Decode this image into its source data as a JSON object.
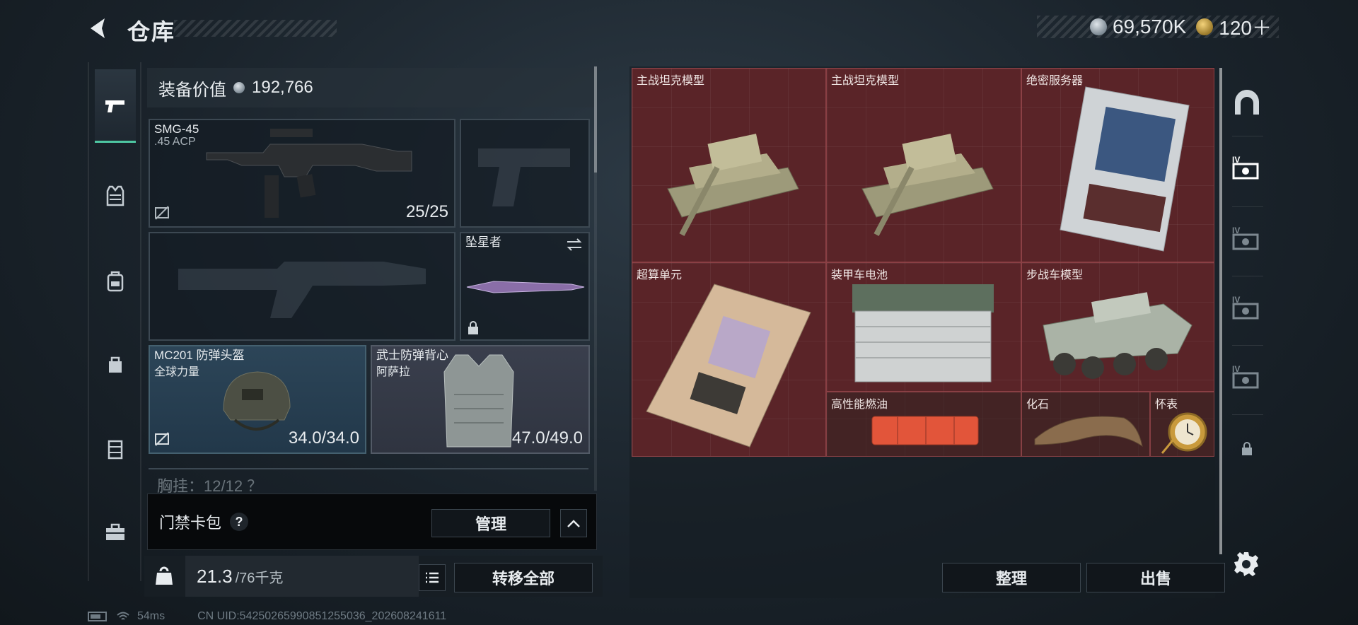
{
  "header": {
    "title": "仓库",
    "currencies": [
      {
        "name": "silver-coin",
        "value": "69,570K",
        "color": "#aab4bb"
      },
      {
        "name": "gold-coin",
        "value": "120＋",
        "color": "#d2a94a"
      }
    ]
  },
  "left_nav": {
    "items": [
      {
        "name": "nav-weapons",
        "icon": "pistol-icon",
        "active": true
      },
      {
        "name": "nav-vest",
        "icon": "vest-icon",
        "active": false
      },
      {
        "name": "nav-backpack",
        "icon": "backpack-icon",
        "active": false
      },
      {
        "name": "nav-pouch",
        "icon": "pouch-icon",
        "active": false
      },
      {
        "name": "nav-case",
        "icon": "case-icon",
        "active": false
      },
      {
        "name": "nav-toolbox",
        "icon": "toolbox-icon",
        "active": false
      }
    ],
    "accent": "#4ec7a2"
  },
  "equipment": {
    "value_label": "装备价值",
    "value": "192,766",
    "primary_weapon": {
      "name": "SMG-45",
      "ammo": ".45 ACP",
      "count": "25/25"
    },
    "melee": {
      "name": "坠星者"
    },
    "helmet": {
      "name": "MC201 防弹头盔",
      "sub": "全球力量",
      "durability": "34.0/34.0"
    },
    "armor": {
      "name": "武士防弹背心",
      "sub": "阿萨拉",
      "durability": "47.0/49.0"
    },
    "belt_label": "胸挂：12/12 ？",
    "keycard_label": "门禁卡包",
    "keycard_help": "?",
    "manage_label": "管理",
    "weight_current": "21.3",
    "weight_max": "/76千克",
    "weight_icon_text": "KG",
    "transfer_all_label": "转移全部"
  },
  "storage": {
    "items": [
      {
        "label": "主战坦克模型",
        "icon": "tank-model-icon"
      },
      {
        "label": "主战坦克模型",
        "icon": "tank-model-icon"
      },
      {
        "label": "绝密服务器",
        "icon": "server-icon"
      },
      {
        "label": "超算单元",
        "icon": "compute-unit-icon"
      },
      {
        "label": "装甲车电池",
        "icon": "battery-icon"
      },
      {
        "label": "步战车模型",
        "icon": "ifv-model-icon"
      },
      {
        "label": "高性能燃油",
        "icon": "fuel-icon"
      },
      {
        "label": "化石",
        "icon": "fossil-icon"
      },
      {
        "label": "怀表",
        "icon": "pocket-watch-icon"
      }
    ],
    "rarity_color": "#5a2428",
    "sort_label": "整理",
    "sell_label": "出售"
  },
  "right_nav": {
    "tabs": [
      {
        "name": "tab-home",
        "icon": "arch-icon",
        "label": ""
      },
      {
        "name": "tab-storage-1",
        "icon": "storage-tier-icon",
        "label": "IV"
      },
      {
        "name": "tab-storage-2",
        "icon": "storage-tier-icon",
        "label": "IV"
      },
      {
        "name": "tab-storage-3",
        "icon": "storage-tier-icon",
        "label": "IV"
      },
      {
        "name": "tab-storage-4",
        "icon": "storage-tier-icon",
        "label": "IV"
      },
      {
        "name": "tab-locked",
        "icon": "lock-icon",
        "label": ""
      }
    ]
  },
  "status": {
    "ping": "54ms",
    "uid": "CN UID:5425026599085125503​6_202608241611"
  }
}
